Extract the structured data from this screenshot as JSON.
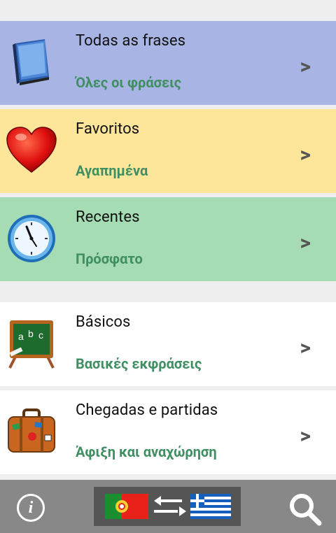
{
  "menu": [
    {
      "title": "Todas as frases",
      "subtitle": "Όλες οι φράσεις",
      "icon": "book-icon",
      "bg": "#a8b4e3",
      "arrow": ">"
    },
    {
      "title": "Favoritos",
      "subtitle": "Αγαπημένα",
      "icon": "heart-icon",
      "bg": "#fde69a",
      "arrow": ">"
    },
    {
      "title": "Recentes",
      "subtitle": "Πρόσφατο",
      "icon": "clock-icon",
      "bg": "#a6dcb3",
      "arrow": ">"
    },
    {
      "title": "Básicos",
      "subtitle": "Βασικές εκφράσεις",
      "icon": "chalkboard-icon",
      "bg": "#ffffff",
      "arrow": ">"
    },
    {
      "title": "Chegadas e partidas",
      "subtitle": "Άφιξη και αναχώρηση",
      "icon": "suitcase-icon",
      "bg": "#ffffff",
      "arrow": ">"
    }
  ],
  "bottom_bar": {
    "info_label": "i",
    "source_flag": "portugal-flag-icon",
    "swap_icon": "swap-arrows-icon",
    "target_flag": "greece-flag-icon",
    "search_icon": "search-icon"
  },
  "colors": {
    "subtitle": "#3f8f62",
    "bottom_bar": "#888888",
    "flag_panel": "#555555"
  }
}
